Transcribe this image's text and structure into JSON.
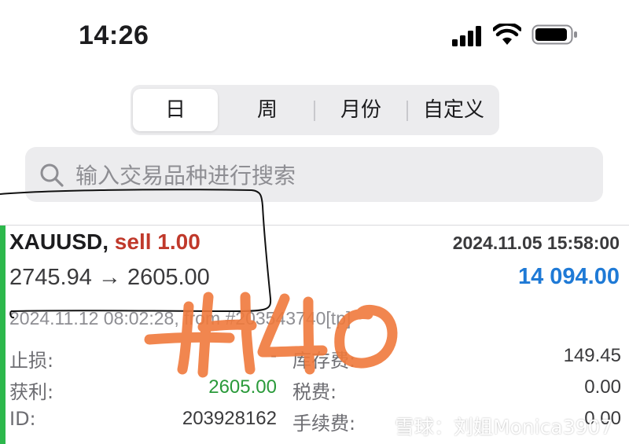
{
  "status_bar": {
    "time": "14:26"
  },
  "tabs": [
    {
      "label": "日",
      "active": true
    },
    {
      "label": "周",
      "active": false
    },
    {
      "label": "月份",
      "active": false
    },
    {
      "label": "自定义",
      "active": false
    }
  ],
  "search": {
    "placeholder": "输入交易品种进行搜索"
  },
  "trade": {
    "symbol": "XAUUSD,",
    "side": "sell 1.00",
    "close_time": "2024.11.05 15:58:00",
    "price_path": "2745.94 → 2605.00",
    "profit": "14 094.00",
    "meta": "2024.11.12 08:02:28, from #203543740[tp]",
    "fields": {
      "sl_label": "止损:",
      "sl_value": "-",
      "swap_label": "库存费:",
      "swap_value": "149.45",
      "tp_label": "获利:",
      "tp_value": "2605.00",
      "tax_label": "税费:",
      "tax_value": "0.00",
      "id_label": "ID:",
      "id_value": "203928162",
      "commission_label": "手续费:",
      "commission_value": "0.00"
    }
  },
  "watermark": "雪球：刘姐Monica3907",
  "colors": {
    "accent_green": "#2db84c",
    "sell_red": "#c0392b",
    "profit_blue": "#1f7ad6",
    "annotation_orange": "#f07a3c"
  }
}
